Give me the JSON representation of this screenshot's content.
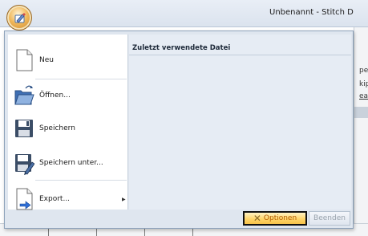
{
  "window": {
    "title": "Unbenannt - Stitch D"
  },
  "menu": {
    "items": [
      {
        "label": "Neu",
        "icon": "new-document-icon"
      },
      {
        "label": "Öffnen...",
        "icon": "open-folder-icon"
      },
      {
        "label": "Speichern",
        "icon": "save-disk-icon"
      },
      {
        "label": "Speichern unter...",
        "icon": "save-as-icon"
      },
      {
        "label": "Export...",
        "icon": "export-icon",
        "has_submenu": true
      }
    ],
    "recent_header": "Zuletzt verwendete Datei",
    "options_label": "Optionen",
    "exit_label": "Beenden"
  },
  "background": {
    "snippets": [
      "pe",
      "kip",
      "ea"
    ]
  },
  "colors": {
    "accent": "#ffd56a",
    "options_text": "#b35b00",
    "menu_bg": "#dfe6ef"
  }
}
